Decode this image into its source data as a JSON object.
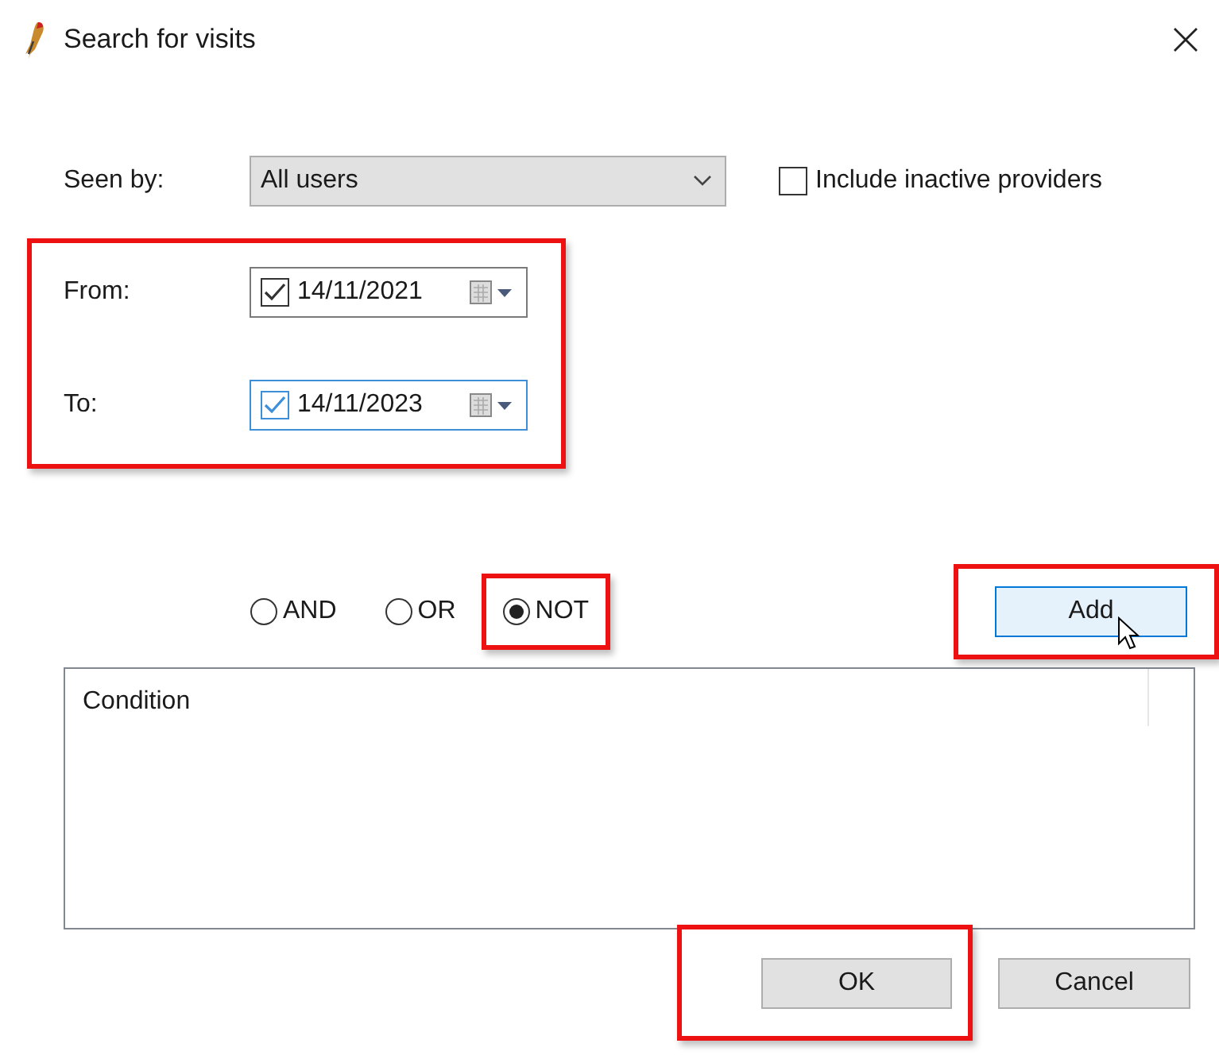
{
  "window": {
    "title": "Search for visits"
  },
  "seen_by": {
    "label": "Seen by:",
    "value": "All users"
  },
  "include_inactive": {
    "label": "Include inactive providers",
    "checked": false
  },
  "date_range": {
    "highlighted": true,
    "fields": [
      {
        "label": "From:",
        "value": "14/11/2021",
        "checked": true,
        "focused": false
      },
      {
        "label": "To:",
        "value": "14/11/2023",
        "checked": true,
        "focused": true
      }
    ]
  },
  "operators": [
    {
      "label": "AND",
      "selected": false,
      "highlighted": false
    },
    {
      "label": "OR",
      "selected": false,
      "highlighted": false
    },
    {
      "label": "NOT",
      "selected": true,
      "highlighted": true
    }
  ],
  "add_button": {
    "label": "Add",
    "highlighted": true,
    "hovered": true
  },
  "conditions": {
    "columns": [
      "Condition"
    ]
  },
  "buttons": [
    {
      "label": "OK",
      "highlighted": true
    },
    {
      "label": "Cancel",
      "highlighted": false
    }
  ]
}
